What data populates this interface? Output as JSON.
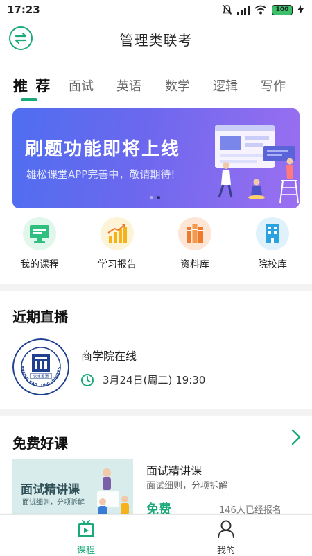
{
  "status_bar": {
    "time": "17:23",
    "battery": "100"
  },
  "header": {
    "title": "管理类联考",
    "menu_icon": "swap-arrows-icon"
  },
  "tabs": [
    {
      "label": "推 荐",
      "active": true
    },
    {
      "label": "面试",
      "active": false
    },
    {
      "label": "英语",
      "active": false
    },
    {
      "label": "数学",
      "active": false
    },
    {
      "label": "逻辑",
      "active": false
    },
    {
      "label": "写作",
      "active": false
    }
  ],
  "banner": {
    "title": "刷题功能即将上线",
    "subtitle": "雄松课堂APP完善中，敬请期待!",
    "slides": 2,
    "current_slide": 2
  },
  "quick_links": [
    {
      "label": "我的课程",
      "icon": "monitor-icon",
      "color": "#2fc081"
    },
    {
      "label": "学习报告",
      "icon": "bar-chart-icon",
      "color": "#f5b21b"
    },
    {
      "label": "资料库",
      "icon": "books-icon",
      "color": "#f07a2c"
    },
    {
      "label": "院校库",
      "icon": "building-icon",
      "color": "#2aa3e0"
    }
  ],
  "live_section": {
    "title": "近期直播",
    "item": {
      "name": "商学院在线",
      "time": "3月24日(周二) 19:30",
      "logo_text": "SHANGHAI JIAO TONG UNIVERSITY",
      "logo_motto": "饮水思源"
    }
  },
  "free_section": {
    "title": "免费好课",
    "course": {
      "thumb_title": "面试精讲课",
      "thumb_subtitle": "面试细则，分项拆解",
      "name": "面试精讲课",
      "description": "面试细则，分项拆解",
      "price": "免费",
      "enrolled": "146人已经报名"
    }
  },
  "bottom_nav": [
    {
      "label": "课程",
      "icon": "tv-play-icon",
      "active": true
    },
    {
      "label": "我的",
      "icon": "person-icon",
      "active": false
    }
  ],
  "colors": {
    "accent": "#1aa97a",
    "text": "#222222",
    "muted": "#666666"
  }
}
